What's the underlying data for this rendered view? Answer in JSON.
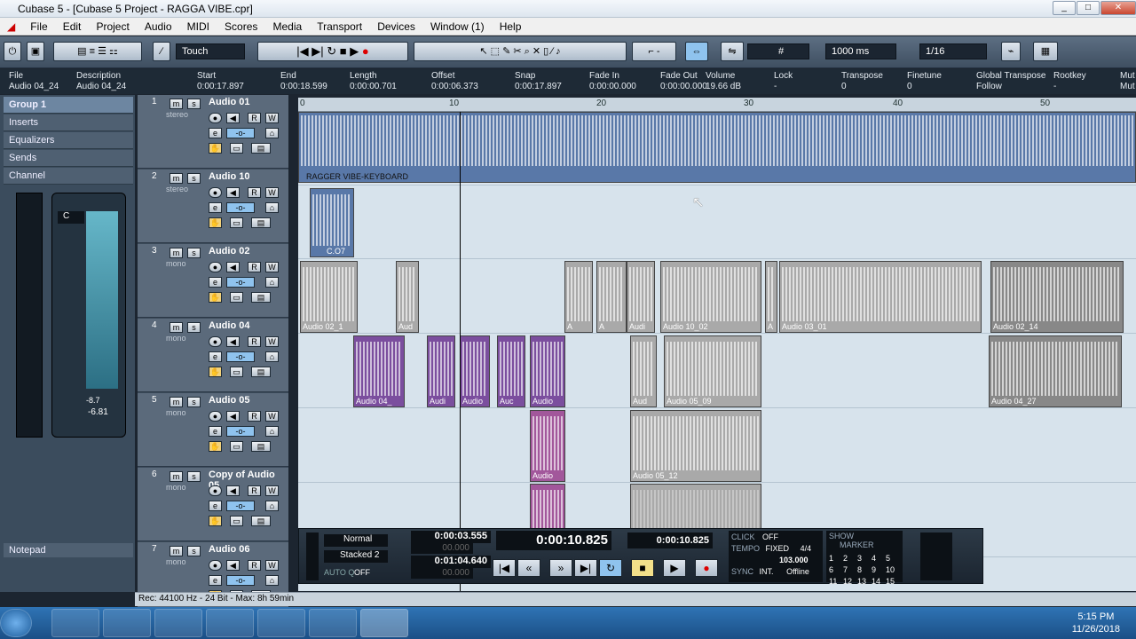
{
  "window": {
    "title": "Cubase 5 - [Cubase 5 Project - RAGGA VIBE.cpr]"
  },
  "menu": [
    "File",
    "Edit",
    "Project",
    "Audio",
    "MIDI",
    "Scores",
    "Media",
    "Transport",
    "Devices",
    "Window (1)",
    "Help"
  ],
  "toolbar": {
    "automation_mode": "Touch",
    "grid": "1000 ms",
    "quantize": "1/16"
  },
  "info_line": {
    "headers": [
      "File",
      "Description",
      "Start",
      "End",
      "Length",
      "Offset",
      "Snap",
      "Fade In",
      "Fade Out",
      "Volume",
      "Lock",
      "Transpose",
      "Finetune",
      "Global Transpose",
      "Rootkey",
      "Mut"
    ],
    "values": [
      "Audio 04_24",
      "Audio 04_24",
      "0:00:17.897",
      "0:00:18.599",
      "0:00:00.701",
      "0:00:06.373",
      "0:00:17.897",
      "0:00:00.000",
      "0:00:00.000",
      "19.66 dB",
      "-",
      "0",
      "0",
      "Follow",
      "-",
      "Mut"
    ]
  },
  "inspector": {
    "group": "Group 1",
    "sections": [
      "Inserts",
      "Equalizers",
      "Sends",
      "Channel"
    ],
    "notepad": "Notepad",
    "fader_values": [
      "-8.7",
      "-6.81"
    ],
    "pan": "C"
  },
  "tracks": [
    {
      "num": "1",
      "name": "Audio 01",
      "type": "stereo"
    },
    {
      "num": "2",
      "name": "Audio 10",
      "type": "stereo"
    },
    {
      "num": "3",
      "name": "Audio 02",
      "type": "mono"
    },
    {
      "num": "4",
      "name": "Audio 04",
      "type": "mono"
    },
    {
      "num": "5",
      "name": "Audio 05",
      "type": "mono"
    },
    {
      "num": "6",
      "name": "Copy of Audio 05",
      "type": "mono"
    },
    {
      "num": "7",
      "name": "Audio 06",
      "type": "mono"
    }
  ],
  "ruler": [
    "0",
    "10",
    "20",
    "30",
    "40",
    "50"
  ],
  "clips": {
    "t1": "RAGGER VIBE-KEYBOARD",
    "t2": "C.O7",
    "t3": [
      "Audio 02_1",
      "Aud",
      "A",
      "A",
      "Audi",
      "Audio 10_02",
      "A",
      "Audio 03_01",
      "Audio 02_14"
    ],
    "t4": [
      "Audio 04_",
      "Audi",
      "Audio",
      "Auc",
      "Audio",
      "Aud",
      "Audio 05_09",
      "Audio 04_27"
    ],
    "t5": [
      "Audio",
      "Audio 05_12"
    ]
  },
  "transport": {
    "mode": "Normal",
    "stacked": "Stacked 2",
    "autoq": "AUTO Q",
    "autoq_val": "OFF",
    "left": "0:00:03.555",
    "left2": "00.000",
    "right": "0:01:04.640",
    "right2": "00.000",
    "main_time": "0:00:10.825",
    "sec_time": "0:00:10.825",
    "click": "CLICK",
    "click_val": "OFF",
    "tempo": "TEMPO",
    "fixed": "FIXED",
    "sig": "4/4",
    "bpm": "103.000",
    "sync": "SYNC",
    "int": "INT.",
    "offline": "Offline",
    "show": "SHOW",
    "marker": "MARKER",
    "markers": [
      "1",
      "2",
      "3",
      "4",
      "5",
      "6",
      "7",
      "8",
      "9",
      "10",
      "11",
      "12",
      "13",
      "14",
      "15"
    ]
  },
  "status": "Rec: 44100 Hz - 24 Bit - Max: 8h 59min",
  "clock": {
    "time": "5:15 PM",
    "date": "11/26/2018"
  }
}
